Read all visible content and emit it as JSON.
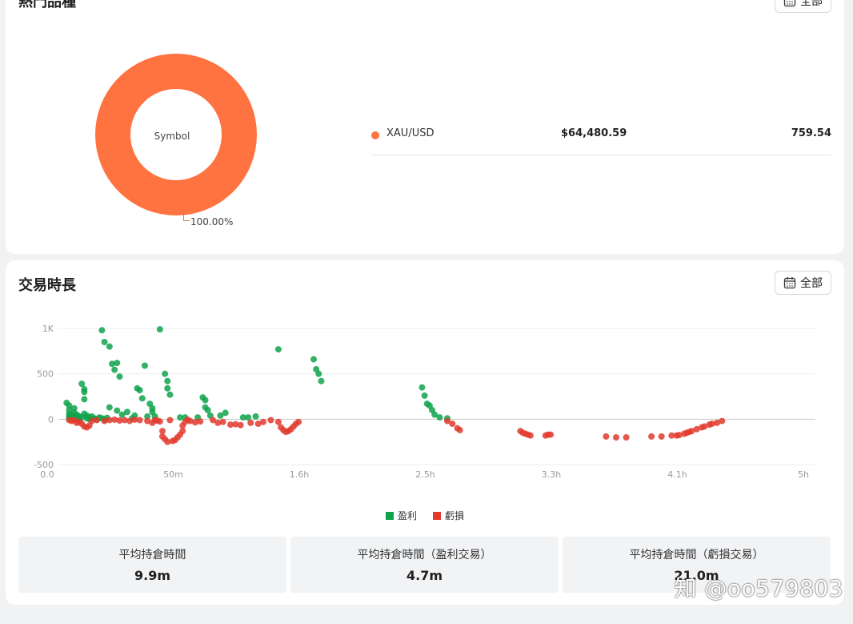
{
  "top_card": {
    "title": "熱門品種",
    "filter_label": "全部",
    "donut_center": "Symbol",
    "donut_pct": "100.00%",
    "donut_color": "#ff7340",
    "rows": [
      {
        "symbol": "XAU/USD",
        "value": "$64,480.59",
        "count": "759.54",
        "color": "#ff7340"
      }
    ]
  },
  "duration_card": {
    "title": "交易時長",
    "filter_label": "全部",
    "legend": {
      "profit": "盈利",
      "loss": "虧損"
    },
    "stats": [
      {
        "label": "平均持倉時間",
        "value": "9.9m"
      },
      {
        "label": "平均持倉時間（盈利交易）",
        "value": "4.7m"
      },
      {
        "label": "平均持倉時間（虧損交易）",
        "value": "21.0m"
      }
    ]
  },
  "colors": {
    "profit": "#0fa34b",
    "loss": "#e23b2e"
  },
  "chart_data": {
    "type": "scatter",
    "x_tick_labels": [
      "0.0",
      "50m",
      "1.6h",
      "2.5h",
      "3.3h",
      "4.1h",
      "5h"
    ],
    "y_tick_labels": [
      "1K",
      "500",
      "0",
      "-500"
    ],
    "xlim_minutes": [
      0,
      300
    ],
    "ylim": [
      -500,
      1000
    ],
    "series": [
      {
        "name": "盈利",
        "points": [
          [
            2,
            180
          ],
          [
            3,
            150
          ],
          [
            3,
            100
          ],
          [
            3,
            60
          ],
          [
            3,
            30
          ],
          [
            3,
            10
          ],
          [
            4,
            0
          ],
          [
            4,
            40
          ],
          [
            5,
            120
          ],
          [
            5,
            70
          ],
          [
            5,
            20
          ],
          [
            6,
            10
          ],
          [
            6,
            50
          ],
          [
            7,
            0
          ],
          [
            7,
            30
          ],
          [
            8,
            20
          ],
          [
            8,
            390
          ],
          [
            9,
            330
          ],
          [
            9,
            300
          ],
          [
            9,
            220
          ],
          [
            9,
            60
          ],
          [
            10,
            10
          ],
          [
            10,
            40
          ],
          [
            11,
            0
          ],
          [
            11,
            20
          ],
          [
            12,
            30
          ],
          [
            13,
            10
          ],
          [
            14,
            0
          ],
          [
            15,
            20
          ],
          [
            16,
            10
          ],
          [
            17,
            0
          ],
          [
            18,
            15
          ],
          [
            16,
            980
          ],
          [
            17,
            850
          ],
          [
            19,
            800
          ],
          [
            19,
            130
          ],
          [
            20,
            610
          ],
          [
            21,
            545
          ],
          [
            22,
            620
          ],
          [
            22,
            95
          ],
          [
            23,
            470
          ],
          [
            24,
            50
          ],
          [
            26,
            80
          ],
          [
            28,
            10
          ],
          [
            29,
            40
          ],
          [
            30,
            340
          ],
          [
            31,
            320
          ],
          [
            32,
            230
          ],
          [
            33,
            590
          ],
          [
            34,
            30
          ],
          [
            35,
            170
          ],
          [
            36,
            120
          ],
          [
            36,
            80
          ],
          [
            37,
            30
          ],
          [
            39,
            990
          ],
          [
            41,
            500
          ],
          [
            42,
            420
          ],
          [
            42,
            340
          ],
          [
            43,
            270
          ],
          [
            47,
            20
          ],
          [
            49,
            20
          ],
          [
            54,
            20
          ],
          [
            56,
            240
          ],
          [
            57,
            210
          ],
          [
            57,
            130
          ],
          [
            58,
            100
          ],
          [
            59,
            40
          ],
          [
            63,
            40
          ],
          [
            65,
            70
          ],
          [
            72,
            20
          ],
          [
            74,
            20
          ],
          [
            77,
            30
          ],
          [
            86,
            770
          ],
          [
            100,
            660
          ],
          [
            101,
            550
          ],
          [
            102,
            500
          ],
          [
            103,
            420
          ],
          [
            143,
            350
          ],
          [
            144,
            260
          ],
          [
            145,
            170
          ],
          [
            146,
            150
          ],
          [
            147,
            100
          ],
          [
            148,
            50
          ],
          [
            150,
            20
          ],
          [
            153,
            10
          ]
        ]
      },
      {
        "name": "虧損",
        "points": [
          [
            3,
            -10
          ],
          [
            4,
            -20
          ],
          [
            5,
            -10
          ],
          [
            6,
            -40
          ],
          [
            7,
            -30
          ],
          [
            8,
            -50
          ],
          [
            9,
            -80
          ],
          [
            10,
            -90
          ],
          [
            11,
            -70
          ],
          [
            12,
            -20
          ],
          [
            14,
            -10
          ],
          [
            17,
            -20
          ],
          [
            19,
            -10
          ],
          [
            21,
            -5
          ],
          [
            23,
            -15
          ],
          [
            25,
            -10
          ],
          [
            27,
            -20
          ],
          [
            29,
            -5
          ],
          [
            31,
            -10
          ],
          [
            34,
            -20
          ],
          [
            36,
            -40
          ],
          [
            37,
            -10
          ],
          [
            38,
            -15
          ],
          [
            39,
            -25
          ],
          [
            40,
            -130
          ],
          [
            40,
            -190
          ],
          [
            41,
            -220
          ],
          [
            42,
            -250
          ],
          [
            43,
            -10
          ],
          [
            44,
            -240
          ],
          [
            45,
            -230
          ],
          [
            46,
            -200
          ],
          [
            47,
            -170
          ],
          [
            48,
            -130
          ],
          [
            48,
            -70
          ],
          [
            49,
            -30
          ],
          [
            50,
            -5
          ],
          [
            51,
            -20
          ],
          [
            53,
            -35
          ],
          [
            55,
            -25
          ],
          [
            60,
            -10
          ],
          [
            62,
            -40
          ],
          [
            64,
            -30
          ],
          [
            67,
            -60
          ],
          [
            69,
            -55
          ],
          [
            71,
            -65
          ],
          [
            75,
            -40
          ],
          [
            78,
            -50
          ],
          [
            80,
            -30
          ],
          [
            83,
            -10
          ],
          [
            86,
            -30
          ],
          [
            87,
            -90
          ],
          [
            88,
            -120
          ],
          [
            89,
            -140
          ],
          [
            90,
            -130
          ],
          [
            91,
            -110
          ],
          [
            92,
            -80
          ],
          [
            93,
            -50
          ],
          [
            94,
            -30
          ],
          [
            153,
            -20
          ],
          [
            155,
            -50
          ],
          [
            157,
            -100
          ],
          [
            158,
            -120
          ],
          [
            182,
            -130
          ],
          [
            183,
            -150
          ],
          [
            184,
            -160
          ],
          [
            185,
            -170
          ],
          [
            186,
            -180
          ],
          [
            192,
            -180
          ],
          [
            193,
            -170
          ],
          [
            194,
            -170
          ],
          [
            216,
            -190
          ],
          [
            220,
            -200
          ],
          [
            224,
            -200
          ],
          [
            234,
            -190
          ],
          [
            238,
            -190
          ],
          [
            242,
            -180
          ],
          [
            244,
            -180
          ],
          [
            245,
            -175
          ],
          [
            247,
            -160
          ],
          [
            248,
            -150
          ],
          [
            249,
            -140
          ],
          [
            250,
            -130
          ],
          [
            252,
            -110
          ],
          [
            254,
            -90
          ],
          [
            255,
            -80
          ],
          [
            257,
            -60
          ],
          [
            258,
            -50
          ],
          [
            260,
            -40
          ],
          [
            262,
            -20
          ]
        ]
      }
    ]
  }
}
